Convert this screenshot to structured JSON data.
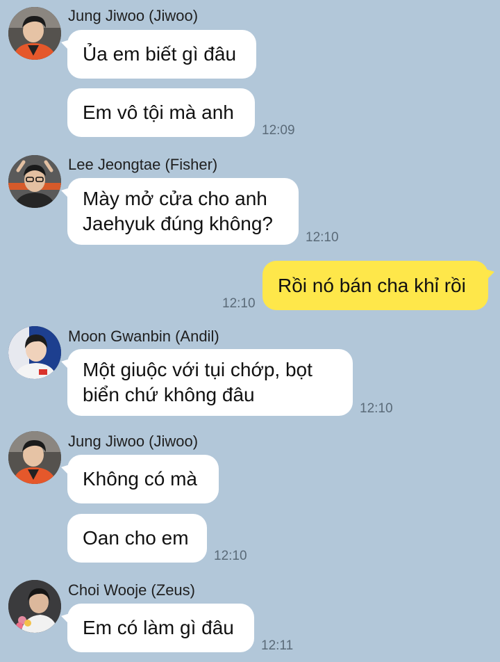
{
  "groups": [
    {
      "sender": "Jung Jiwoo (Jiwoo)",
      "avatar_icon": "person-orange-jersey-avatar",
      "messages": [
        {
          "lines": [
            "Ủa em biết gì đâu"
          ],
          "time": ""
        },
        {
          "lines": [
            "Em vô tội mà anh"
          ],
          "time": "12:09"
        }
      ]
    },
    {
      "sender": "Lee Jeongtae (Fisher)",
      "avatar_icon": "person-glasses-avatar",
      "messages": [
        {
          "lines": [
            "Mày mở cửa cho anh",
            "Jaehyuk đúng không?"
          ],
          "time": "12:10"
        }
      ]
    },
    {
      "sender": "",
      "mine": true,
      "messages": [
        {
          "lines": [
            "Rồi nó bán cha khỉ rồi"
          ],
          "time": "12:10"
        }
      ]
    },
    {
      "sender": "Moon Gwanbin (Andil)",
      "avatar_icon": "person-white-jersey-avatar",
      "messages": [
        {
          "lines": [
            "Một giuộc với tụi chớp, bọt",
            "biển chứ không đâu"
          ],
          "time": "12:10"
        }
      ]
    },
    {
      "sender": "Jung Jiwoo (Jiwoo)",
      "avatar_icon": "person-orange-jersey-avatar",
      "messages": [
        {
          "lines": [
            "Không có mà"
          ],
          "time": ""
        },
        {
          "lines": [
            "Oan cho em"
          ],
          "time": "12:10"
        }
      ]
    },
    {
      "sender": "Choi Wooje (Zeus)",
      "avatar_icon": "person-flowers-avatar",
      "messages": [
        {
          "lines": [
            "Em có làm gì đâu"
          ],
          "time": "12:11"
        }
      ]
    }
  ],
  "colors": {
    "background": "#b2c7d9",
    "incoming_bubble": "#ffffff",
    "outgoing_bubble": "#fee74a",
    "timestamp": "#5a6a78"
  }
}
